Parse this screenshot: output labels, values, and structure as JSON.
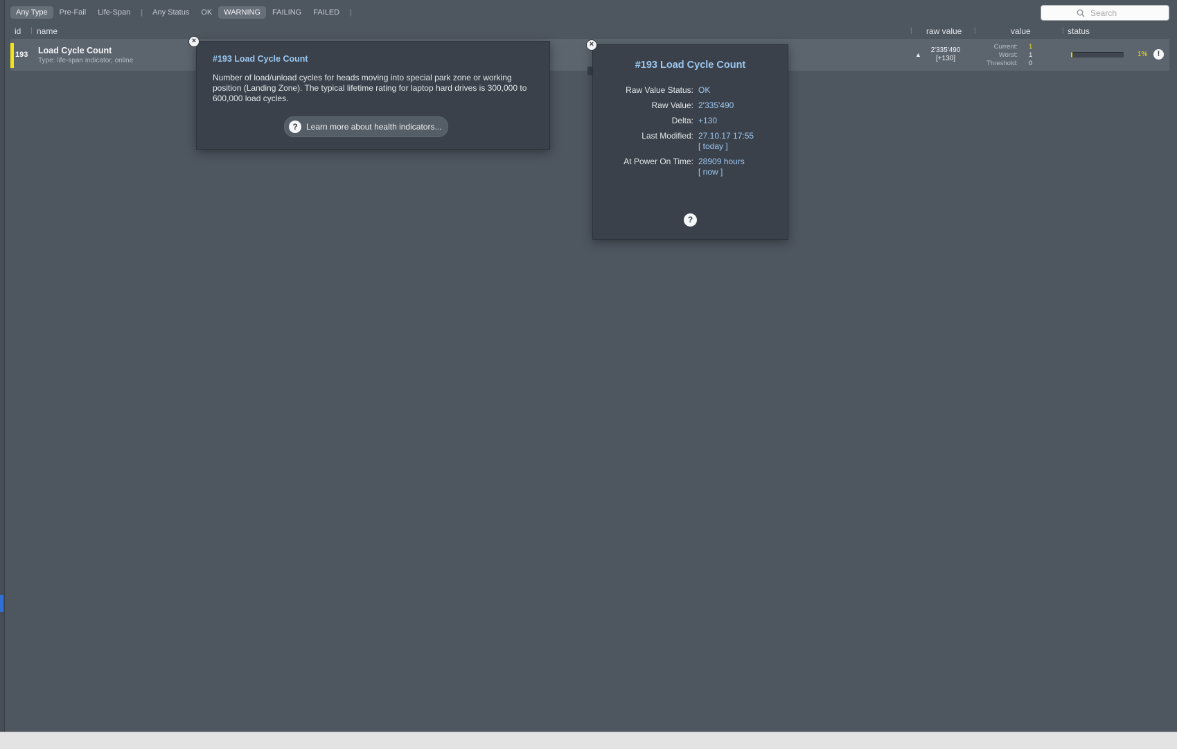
{
  "filters": {
    "type": [
      {
        "label": "Any Type",
        "active": true
      },
      {
        "label": "Pre-Fail",
        "active": false
      },
      {
        "label": "Life-Span",
        "active": false
      }
    ],
    "status": [
      {
        "label": "Any Status",
        "active": false
      },
      {
        "label": "OK",
        "active": false
      },
      {
        "label": "WARNING",
        "active": true
      },
      {
        "label": "FAILING",
        "active": false
      },
      {
        "label": "FAILED",
        "active": false
      }
    ]
  },
  "search": {
    "placeholder": "Search",
    "value": ""
  },
  "columns": {
    "id": "id",
    "name": "name",
    "raw_value": "raw value",
    "value": "value",
    "status": "status"
  },
  "row": {
    "id": "193",
    "name": "Load Cycle Count",
    "type": "Type: life-span indicator, online",
    "raw_value": "2'335'490",
    "raw_delta": "[+130]",
    "labels": {
      "current": "Current:",
      "worst": "Worst:",
      "threshold": "Threshold:"
    },
    "current": "1",
    "worst": "1",
    "threshold": "0",
    "status_fraction": 0.01,
    "status_percent": "1%",
    "flag_color": "#f2e21e"
  },
  "description_popup": {
    "title": "#193 Load Cycle Count",
    "body": "Number of load/unload cycles for heads moving into special park zone or working position (Landing Zone). The typical lifetime rating for laptop hard drives is 300,000 to 600,000 load cycles.",
    "learn_more": "Learn more about health indicators...",
    "close": "×"
  },
  "details_popup": {
    "title": "#193 Load Cycle Count",
    "close": "×",
    "raw_status_label": "Raw Value Status:",
    "raw_status": "OK",
    "raw_value_label": "Raw Value:",
    "raw_value": "2'335'490",
    "delta_label": "Delta:",
    "delta": "+130",
    "modified_label": "Last Modified:",
    "modified": "27.10.17 17:55",
    "modified_link": "[ today ]",
    "power_label": "At Power On Time:",
    "power": "28909 hours",
    "power_link": "[ now ]"
  },
  "icons": {
    "search": "search-icon",
    "help": "question-mark-icon",
    "warning": "exclamation-icon",
    "close": "close-icon",
    "sort": "sort-up-icon"
  },
  "colors": {
    "background": "#4e5660",
    "popup": "#3a414a",
    "link": "#9cc8f2",
    "warning": "#f2e21e"
  }
}
